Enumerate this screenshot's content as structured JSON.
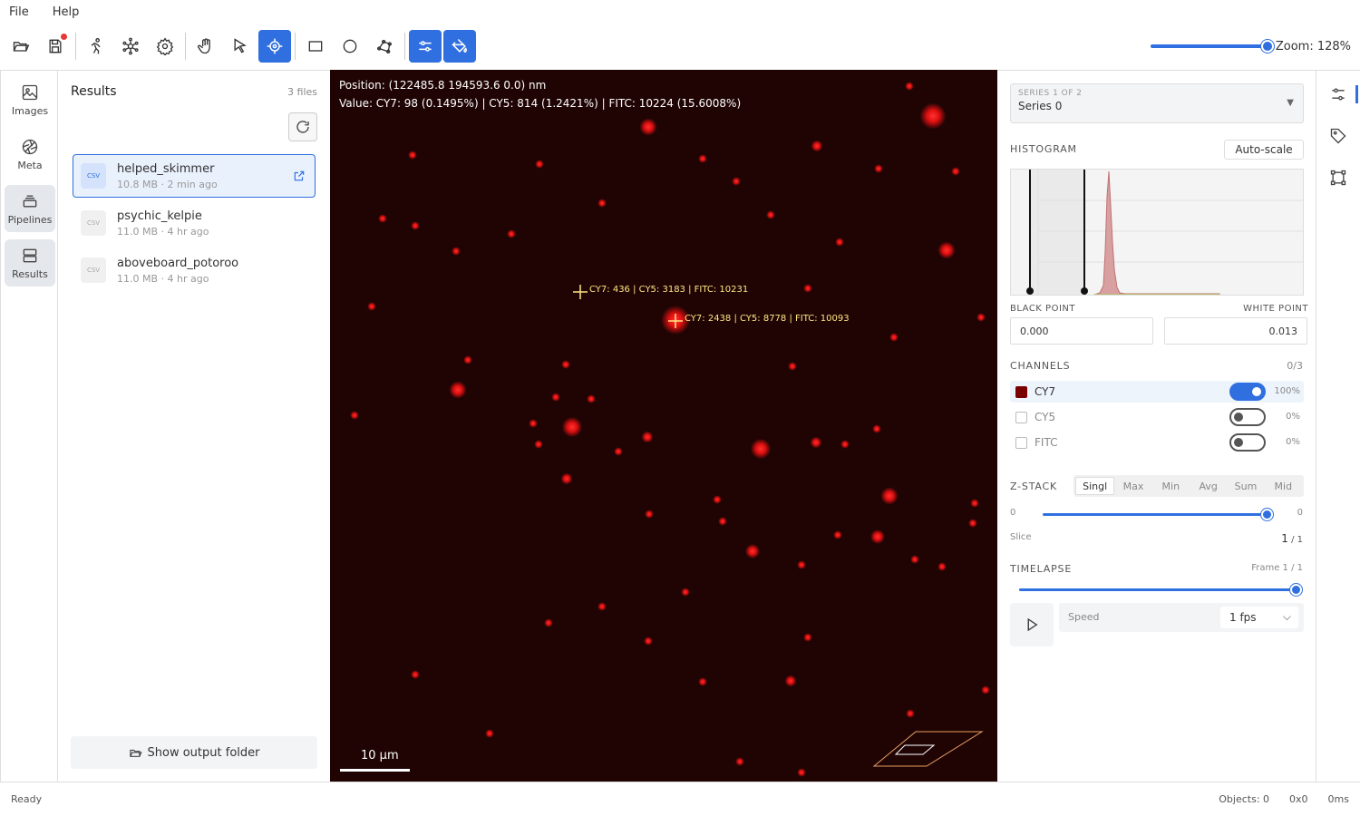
{
  "menu": {
    "file": "File",
    "help": "Help"
  },
  "toolbar": {
    "buttons": [
      "folder-open-icon",
      "save-icon",
      "run-icon",
      "network-icon",
      "settings-icon",
      "hand-icon",
      "pointer-icon",
      "target-icon",
      "rectangle-icon",
      "circle-icon",
      "polygon-icon",
      "adjust-icon",
      "fill-icon"
    ],
    "active": [
      "target-icon",
      "adjust-icon",
      "fill-icon"
    ],
    "zoom_label": "Zoom: 128%",
    "zoom_value": 128
  },
  "rail": [
    {
      "label": "Images",
      "icon": "image-icon"
    },
    {
      "label": "Meta",
      "icon": "aperture-icon"
    },
    {
      "label": "Pipelines",
      "icon": "stack-icon"
    },
    {
      "label": "Results",
      "icon": "database-icon"
    }
  ],
  "results": {
    "title": "Results",
    "count": "3 files",
    "files": [
      {
        "name": "helped_skimmer",
        "size": "10.8 MB",
        "age": "2 min ago",
        "type": "CSV"
      },
      {
        "name": "psychic_kelpie",
        "size": "11.0 MB",
        "age": "4 hr ago",
        "type": "CSV"
      },
      {
        "name": "aboveboard_potoroo",
        "size": "11.0 MB",
        "age": "4 hr ago",
        "type": "CSV"
      }
    ],
    "meta_sep": "·",
    "show_folder": "Show output folder"
  },
  "viewer": {
    "position": "Position: (122485.8 194593.6 0.0) nm",
    "value": "Value: CY7: 98 (0.1495%) | CY5: 814 (1.2421%) | FITC: 10224 (15.6008%)",
    "probes": [
      "CY7: 436 | CY5: 3183 | FITC: 10231",
      "CY7: 2438 | CY5: 8778 | FITC: 10093"
    ],
    "scale": "10 µm",
    "spot_color": "#ff1a1a",
    "bg_color": "#200404"
  },
  "props": {
    "series_sup": "SERIES 1 OF 2",
    "series_value": "Series 0",
    "histogram_label": "HISTOGRAM",
    "autoscale": "Auto-scale",
    "black_point_label": "BLACK POINT",
    "white_point_label": "WHITE POINT",
    "black_point": "0.000",
    "white_point": "0.013",
    "channels_label": "CHANNELS",
    "channels_count": "0/3",
    "channels": [
      {
        "name": "CY7",
        "on": true,
        "pct": "100%",
        "color": "#7a0000"
      },
      {
        "name": "CY5",
        "on": false,
        "pct": "0%",
        "color": ""
      },
      {
        "name": "FITC",
        "on": false,
        "pct": "0%",
        "color": ""
      }
    ],
    "zstack_label": "Z-STACK",
    "zstack_modes": [
      "Singl",
      "Max",
      "Min",
      "Avg",
      "Sum",
      "Mid"
    ],
    "zstack_selected": "Singl",
    "z_min": "0",
    "z_max": "0",
    "slice_label": "Slice",
    "slice_value": "1",
    "slice_total": "/ 1",
    "timelapse_label": "TIMELAPSE",
    "frame": "Frame 1 / 1",
    "speed_label": "Speed",
    "speed_value": "1 fps"
  },
  "right_rail": [
    "sliders-icon",
    "tag-icon",
    "bounding-box-icon"
  ],
  "status": {
    "text": "Ready",
    "objects": "Objects: 0",
    "size": "0x0",
    "time": "0ms"
  }
}
